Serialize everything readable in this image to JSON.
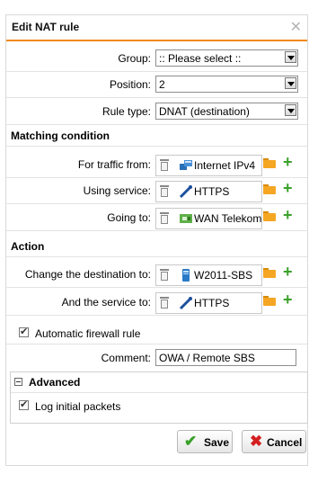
{
  "dialog": {
    "title": "Edit NAT rule",
    "close_icon": "close-icon"
  },
  "fields": {
    "group": {
      "label": "Group:",
      "value": ":: Please select ::"
    },
    "position": {
      "label": "Position:",
      "value": "2"
    },
    "rule_type": {
      "label": "Rule type:",
      "value": "DNAT (destination)"
    }
  },
  "matching": {
    "title": "Matching condition",
    "traffic_from": {
      "label": "For traffic from:",
      "value": "Internet IPv4",
      "icon": "network-icon"
    },
    "using_service": {
      "label": "Using service:",
      "value": "HTTPS",
      "icon": "service-icon"
    },
    "going_to": {
      "label": "Going to:",
      "value": "WAN Telekom",
      "icon": "interface-icon"
    }
  },
  "action": {
    "title": "Action",
    "change_destination": {
      "label": "Change the destination to:",
      "value": "W2011-SBS",
      "icon": "host-icon"
    },
    "and_service": {
      "label": "And the service to:",
      "value": "HTTPS",
      "icon": "service-icon"
    }
  },
  "automatic_firewall": {
    "label": "Automatic firewall rule",
    "checked": true
  },
  "comment": {
    "label": "Comment:",
    "value": "OWA / Remote SBS"
  },
  "advanced": {
    "title": "Advanced",
    "log_initial": {
      "label": "Log initial packets",
      "checked": true
    }
  },
  "buttons": {
    "save": "Save",
    "cancel": "Cancel"
  },
  "colors": {
    "accent": "#f08a1c",
    "plus_green": "#3aa12a",
    "save_green": "#3aa12a",
    "cancel_red": "#d42020",
    "folder": "#f5a623"
  }
}
